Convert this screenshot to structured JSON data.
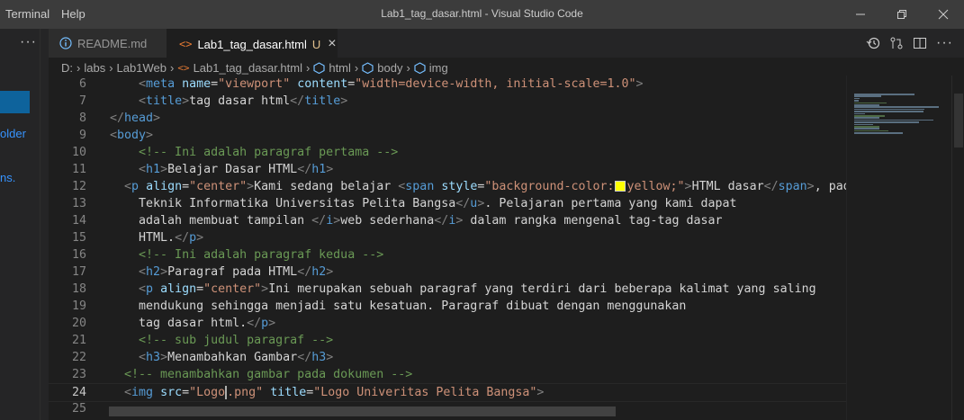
{
  "menu": [
    "Terminal",
    "Help"
  ],
  "window_title": "Lab1_tag_dasar.html - Visual Studio Code",
  "sidebar": {
    "more": "···",
    "fragments": [
      "older",
      "ns."
    ]
  },
  "tabs": [
    {
      "icon": "info-icon",
      "label": "README.md",
      "active": false
    },
    {
      "icon": "html-icon",
      "label": "Lab1_tag_dasar.html",
      "modified": "U",
      "close": "×",
      "active": true
    }
  ],
  "breadcrumb": [
    "D:",
    "labs",
    "Lab1Web",
    "Lab1_tag_dasar.html",
    "html",
    "body",
    "img"
  ],
  "editor": {
    "lines": [
      {
        "n": "6",
        "parts": [
          [
            "",
            "    "
          ],
          [
            "tb",
            "<"
          ],
          [
            "t",
            "meta"
          ],
          [
            "tx",
            " "
          ],
          [
            "a",
            "name"
          ],
          [
            "tx",
            "="
          ],
          [
            "s",
            "\"viewport\""
          ],
          [
            "tx",
            " "
          ],
          [
            "a",
            "content"
          ],
          [
            "tx",
            "="
          ],
          [
            "s",
            "\"width=device-width, initial-scale=1.0\""
          ],
          [
            "tb",
            ">"
          ]
        ]
      },
      {
        "n": "7",
        "parts": [
          [
            "",
            "    "
          ],
          [
            "tb",
            "<"
          ],
          [
            "t",
            "title"
          ],
          [
            "tb",
            ">"
          ],
          [
            "tx",
            "tag dasar html"
          ],
          [
            "tb",
            "</"
          ],
          [
            "t",
            "title"
          ],
          [
            "tb",
            ">"
          ]
        ]
      },
      {
        "n": "8",
        "parts": [
          [
            "tb",
            "</"
          ],
          [
            "t",
            "head"
          ],
          [
            "tb",
            ">"
          ]
        ]
      },
      {
        "n": "9",
        "parts": [
          [
            "tb",
            "<"
          ],
          [
            "t",
            "body"
          ],
          [
            "tb",
            ">"
          ]
        ]
      },
      {
        "n": "10",
        "parts": [
          [
            "",
            "    "
          ],
          [
            "c",
            "<!-- Ini adalah paragraf pertama -->"
          ]
        ]
      },
      {
        "n": "11",
        "parts": [
          [
            "",
            "    "
          ],
          [
            "tb",
            "<"
          ],
          [
            "t",
            "h1"
          ],
          [
            "tb",
            ">"
          ],
          [
            "tx",
            "Belajar Dasar HTML"
          ],
          [
            "tb",
            "</"
          ],
          [
            "t",
            "h1"
          ],
          [
            "tb",
            ">"
          ]
        ]
      },
      {
        "n": "12",
        "parts": [
          [
            "",
            "  "
          ],
          [
            "tb",
            "<"
          ],
          [
            "t",
            "p"
          ],
          [
            "tx",
            " "
          ],
          [
            "a",
            "align"
          ],
          [
            "tx",
            "="
          ],
          [
            "s",
            "\"center\""
          ],
          [
            "tb",
            ">"
          ],
          [
            "tx",
            "Kami sedang belajar "
          ],
          [
            "tb",
            "<"
          ],
          [
            "t",
            "span"
          ],
          [
            "tx",
            " "
          ],
          [
            "a",
            "style"
          ],
          [
            "tx",
            "="
          ],
          [
            "s",
            "\"background-color:"
          ],
          [
            "swatch",
            ""
          ],
          [
            "s",
            "yellow;\""
          ],
          [
            "tb",
            ">"
          ],
          [
            "tx",
            "HTML dasar"
          ],
          [
            "tb",
            "</"
          ],
          [
            "t",
            "span"
          ],
          [
            "tb",
            ">"
          ],
          [
            "tx",
            ", pada m"
          ]
        ]
      },
      {
        "n": "13",
        "parts": [
          [
            "",
            "    "
          ],
          [
            "tx",
            "Teknik Informatika Universitas Pelita Bangsa"
          ],
          [
            "tb",
            "</"
          ],
          [
            "t",
            "u"
          ],
          [
            "tb",
            ">"
          ],
          [
            "tx",
            ". Pelajaran pertama yang kami dapat"
          ]
        ]
      },
      {
        "n": "14",
        "parts": [
          [
            "",
            "    "
          ],
          [
            "tx",
            "adalah membuat tampilan "
          ],
          [
            "tb",
            "</"
          ],
          [
            "t",
            "i"
          ],
          [
            "tb",
            ">"
          ],
          [
            "tx",
            "web sederhana"
          ],
          [
            "tb",
            "</"
          ],
          [
            "t",
            "i"
          ],
          [
            "tb",
            ">"
          ],
          [
            "tx",
            " dalam rangka mengenal tag-tag dasar"
          ]
        ]
      },
      {
        "n": "15",
        "parts": [
          [
            "",
            "    "
          ],
          [
            "tx",
            "HTML."
          ],
          [
            "tb",
            "</"
          ],
          [
            "t",
            "p"
          ],
          [
            "tb",
            ">"
          ]
        ]
      },
      {
        "n": "16",
        "parts": [
          [
            "",
            "    "
          ],
          [
            "c",
            "<!-- Ini adalah paragraf kedua -->"
          ]
        ]
      },
      {
        "n": "17",
        "parts": [
          [
            "",
            "    "
          ],
          [
            "tb",
            "<"
          ],
          [
            "t",
            "h2"
          ],
          [
            "tb",
            ">"
          ],
          [
            "tx",
            "Paragraf pada HTML"
          ],
          [
            "tb",
            "</"
          ],
          [
            "t",
            "h2"
          ],
          [
            "tb",
            ">"
          ]
        ]
      },
      {
        "n": "18",
        "parts": [
          [
            "",
            "    "
          ],
          [
            "tb",
            "<"
          ],
          [
            "t",
            "p"
          ],
          [
            "tx",
            " "
          ],
          [
            "a",
            "align"
          ],
          [
            "tx",
            "="
          ],
          [
            "s",
            "\"center\""
          ],
          [
            "tb",
            ">"
          ],
          [
            "tx",
            "Ini merupakan sebuah paragraf yang terdiri dari beberapa kalimat yang saling"
          ]
        ]
      },
      {
        "n": "19",
        "parts": [
          [
            "",
            "    "
          ],
          [
            "tx",
            "mendukung sehingga menjadi satu kesatuan. Paragraf dibuat dengan menggunakan"
          ]
        ]
      },
      {
        "n": "20",
        "parts": [
          [
            "",
            "    "
          ],
          [
            "tx",
            "tag dasar html."
          ],
          [
            "tb",
            "</"
          ],
          [
            "t",
            "p"
          ],
          [
            "tb",
            ">"
          ]
        ]
      },
      {
        "n": "21",
        "parts": [
          [
            "",
            "    "
          ],
          [
            "c",
            "<!-- sub judul paragraf -->"
          ]
        ]
      },
      {
        "n": "22",
        "parts": [
          [
            "",
            "    "
          ],
          [
            "tb",
            "<"
          ],
          [
            "t",
            "h3"
          ],
          [
            "tb",
            ">"
          ],
          [
            "tx",
            "Menambahkan Gambar"
          ],
          [
            "tb",
            "</"
          ],
          [
            "t",
            "h3"
          ],
          [
            "tb",
            ">"
          ]
        ]
      },
      {
        "n": "23",
        "parts": [
          [
            "",
            "  "
          ],
          [
            "c",
            "<!-- menambahkan gambar pada dokumen -->"
          ]
        ]
      },
      {
        "n": "24",
        "current": true,
        "parts": [
          [
            "",
            "  "
          ],
          [
            "tb",
            "<"
          ],
          [
            "t",
            "img"
          ],
          [
            "tx",
            " "
          ],
          [
            "a",
            "src"
          ],
          [
            "tx",
            "="
          ],
          [
            "s",
            "\"Logo"
          ],
          [
            "cursor",
            ""
          ],
          [
            "s",
            ".png\""
          ],
          [
            "tx",
            " "
          ],
          [
            "a",
            "title"
          ],
          [
            "tx",
            "="
          ],
          [
            "s",
            "\"Logo Univeritas Pelita Bangsa\""
          ],
          [
            "tb",
            ">"
          ]
        ]
      },
      {
        "n": "25",
        "parts": []
      }
    ]
  },
  "colors": {
    "titlebar": "#3c3c3c",
    "editor_bg": "#1e1e1e",
    "tag": "#569cd6",
    "attr": "#9cdcfe",
    "string": "#ce9178",
    "comment": "#6a9955"
  }
}
